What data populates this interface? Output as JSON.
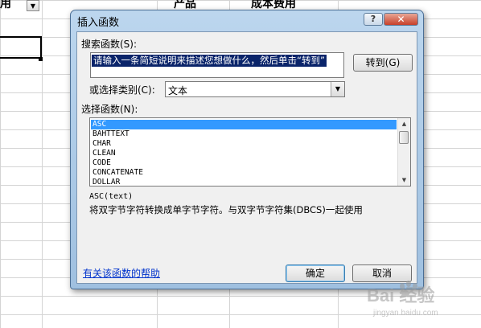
{
  "sheet": {
    "header_left": "用",
    "header_product": "产品",
    "header_cost": "成本费用",
    "filter_arrow": "▼"
  },
  "dialog": {
    "title": "插入函数",
    "help_glyph": "?",
    "close_glyph": "✕",
    "search_label": "搜索函数(S):",
    "search_value": "请输入一条简短说明来描述您想做什么，然后单击“转到”",
    "go_button": "转到(G)",
    "category_label": "或选择类别(C):",
    "category_value": "文本",
    "function_label": "选择函数(N):",
    "functions": [
      "ASC",
      "BAHTTEXT",
      "CHAR",
      "CLEAN",
      "CODE",
      "CONCATENATE",
      "DOLLAR"
    ],
    "selected_function": "ASC",
    "syntax": "ASC(text)",
    "description": "将双字节字符转换成单字节字符。与双字节字符集(DBCS)一起使用",
    "help_link": "有关该函数的帮助",
    "ok_button": "确定",
    "cancel_button": "取消"
  },
  "watermark": {
    "text": "Bai 经验",
    "sub": "jingyan.baidu.com"
  }
}
